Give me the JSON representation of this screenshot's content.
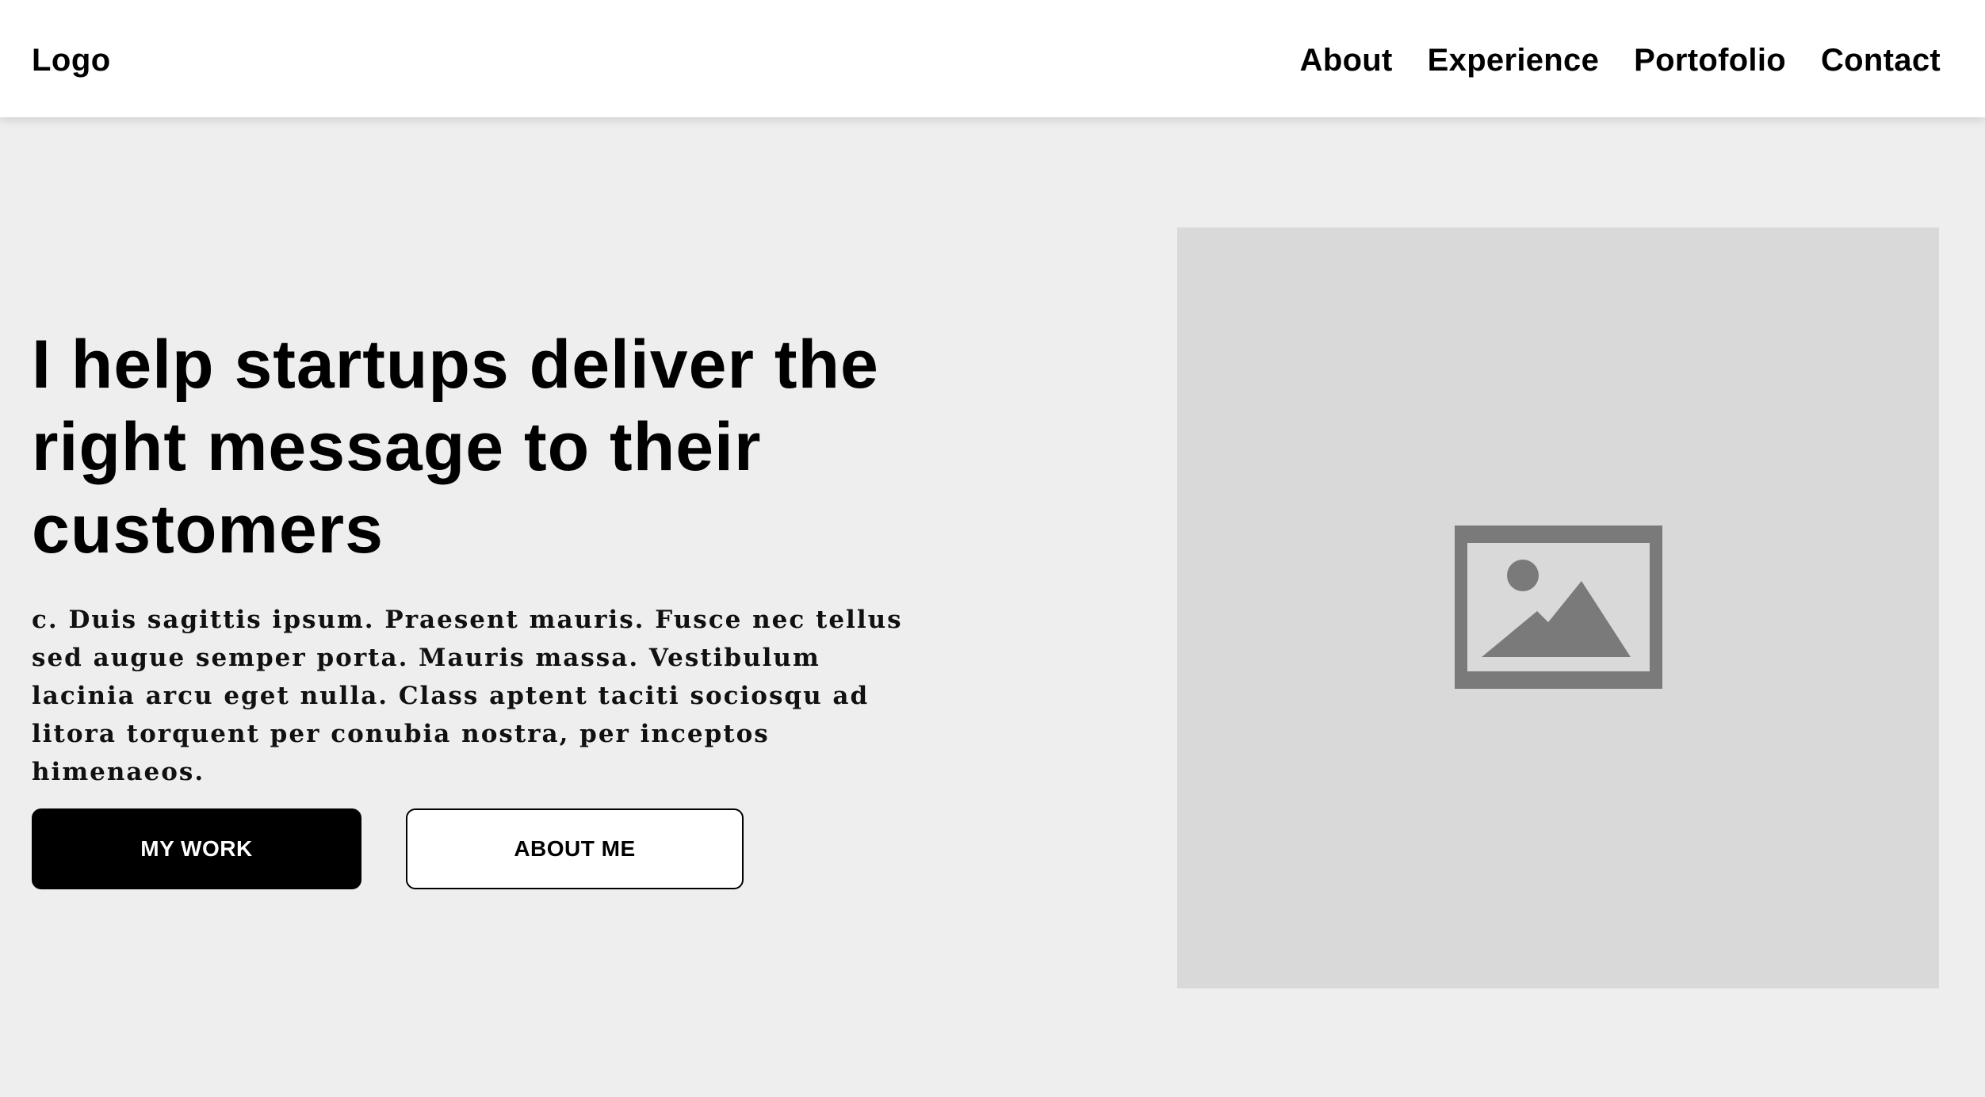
{
  "header": {
    "logo": "Logo",
    "nav": [
      {
        "label": "About"
      },
      {
        "label": "Experience"
      },
      {
        "label": "Portofolio"
      },
      {
        "label": "Contact"
      }
    ]
  },
  "hero": {
    "headline": "I help startups deliver the right message to their customers",
    "body": "c. Duis sagittis ipsum. Praesent mauris. Fusce nec tellus sed augue semper porta. Mauris massa. Vestibulum lacinia arcu eget nulla. Class aptent taciti sociosqu ad litora torquent per conubia nostra, per inceptos himenaeos.",
    "primary_button": "MY WORK",
    "secondary_button": "ABOUT ME",
    "image_icon": "image-placeholder-icon"
  },
  "colors": {
    "page_background": "#eeeeee",
    "header_background": "#ffffff",
    "image_placeholder": "#d9d9d9",
    "image_icon": "#7a7a7a",
    "primary_button": "#000000"
  }
}
